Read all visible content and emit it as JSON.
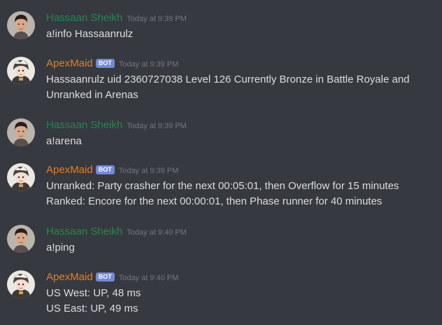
{
  "colors": {
    "background": "#36393f",
    "human_username": "#1f8b4c",
    "bot_username": "#e67e22",
    "bot_tag": "#7289da",
    "message_text": "#dcddde",
    "timestamp": "#72767d"
  },
  "messages": [
    {
      "author": "Hassaan Sheikh",
      "timestamp": "Today at 9:39 PM",
      "lines": [
        "a!info Hassaanrulz"
      ]
    },
    {
      "author": "ApexMaid",
      "bot_tag": "BOT",
      "timestamp": "Today at 9:39 PM",
      "lines": [
        "Hassaanrulz uid 2360727038 Level 126 Currently Bronze in Battle Royale and",
        "Unranked in Arenas"
      ]
    },
    {
      "author": "Hassaan Sheikh",
      "timestamp": "Today at 9:39 PM",
      "lines": [
        "a!arena"
      ]
    },
    {
      "author": "ApexMaid",
      "bot_tag": "BOT",
      "timestamp": "Today at 9:39 PM",
      "lines": [
        "Unranked: Party crasher for the next 00:05:01, then Overflow for 15 minutes",
        "Ranked: Encore for the next 00:00:01, then Phase runner for 40 minutes"
      ]
    },
    {
      "author": "Hassaan Sheikh",
      "timestamp": "Today at 9:40 PM",
      "lines": [
        "a!ping"
      ]
    },
    {
      "author": "ApexMaid",
      "bot_tag": "BOT",
      "timestamp": "Today at 9:40 PM",
      "lines": [
        "US West: UP, 48 ms",
        "US East: UP, 49 ms"
      ]
    }
  ]
}
